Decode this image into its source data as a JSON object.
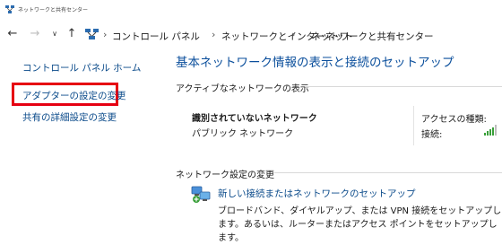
{
  "window": {
    "title": "ネットワークと共有センター"
  },
  "navigation": {
    "back_icon": "←",
    "forward_icon": "→",
    "dropdown_icon": "∨",
    "up_icon": "↑",
    "separator": "›",
    "breadcrumbs": [
      "コントロール パネル",
      "ネットワークとインターネット",
      "ネットワークと共有センター"
    ]
  },
  "sidebar": {
    "home_link": "コントロール パネル ホーム",
    "adapter_link": "アダプターの設定の変更",
    "sharing_link": "共有の詳細設定の変更"
  },
  "main": {
    "title": "基本ネットワーク情報の表示と接続のセットアップ",
    "active_section": "アクティブなネットワークの表示",
    "network": {
      "name": "識別されていないネットワーク",
      "type": "パブリック ネットワーク",
      "access_label": "アクセスの種類:",
      "access_value": "",
      "connection_label": "接続:"
    },
    "settings_section": "ネットワーク設定の変更",
    "setup": {
      "link": "新しい接続またはネットワークのセットアップ",
      "description": "ブロードバンド、ダイヤルアップ、または VPN 接続をセットアップします。あるいは、ルーターまたはアクセス ポイントをセットアップします。"
    }
  },
  "colors": {
    "link": "#0a4a8a",
    "title": "#0b4f9c",
    "highlight": "#e60012"
  }
}
